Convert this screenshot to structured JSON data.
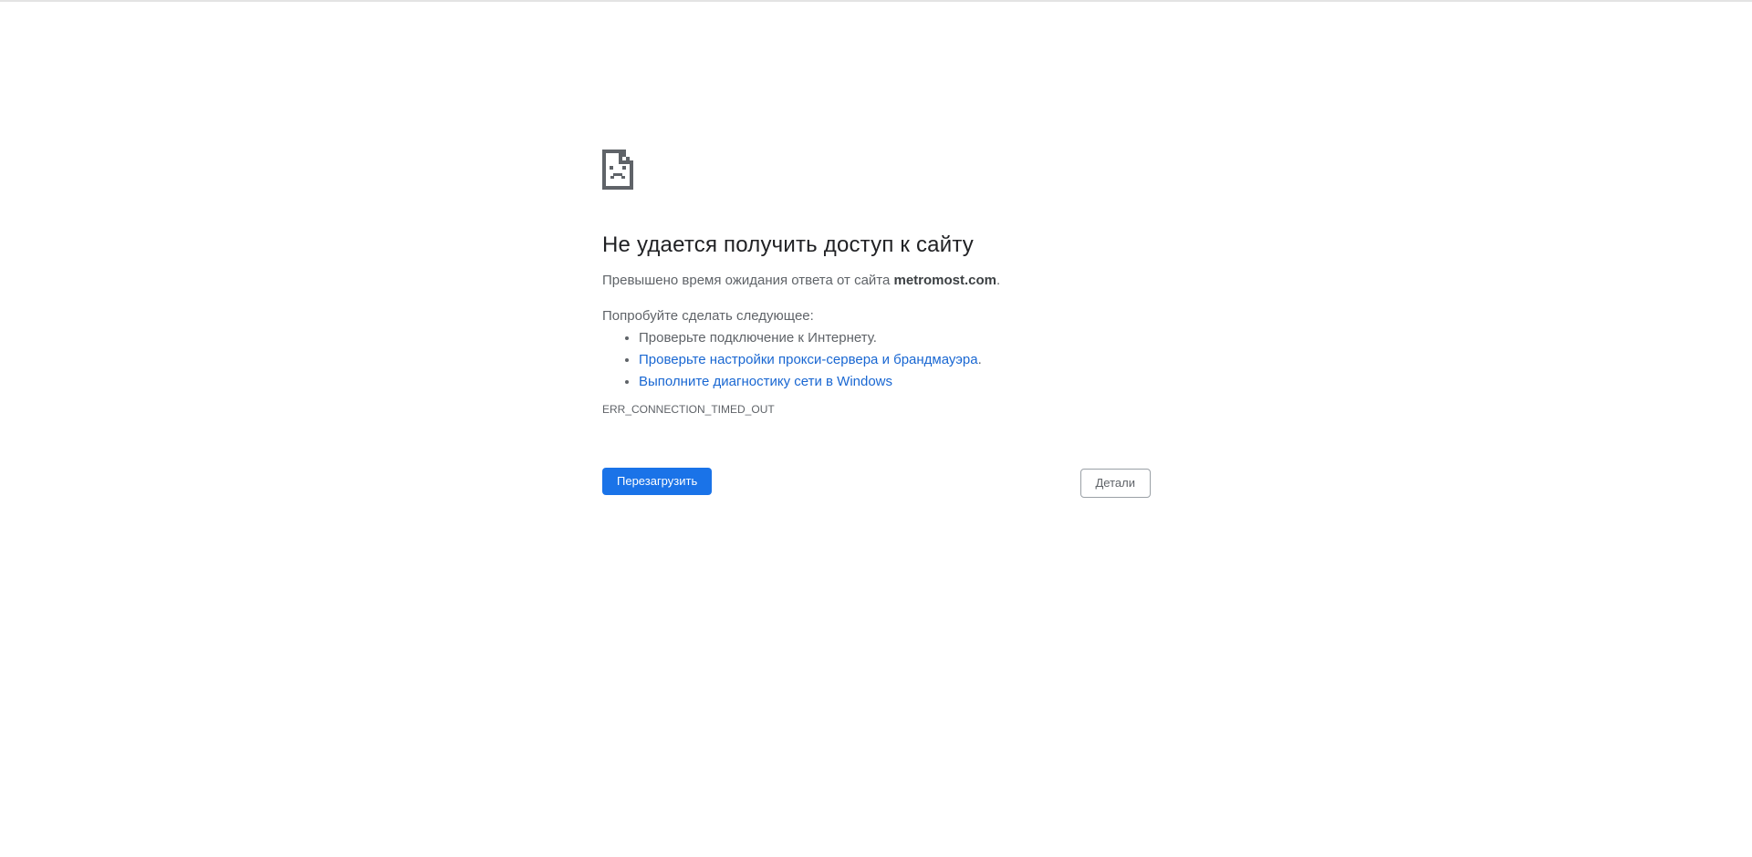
{
  "error_page": {
    "icon": "sad-document-icon",
    "title": "Не удается получить доступ к сайту",
    "summary_prefix": "Превышено время ожидания ответа от сайта ",
    "host": "metromost.com",
    "summary_suffix": ".",
    "suggestions_heading": "Попробуйте сделать следующее:",
    "suggestions": [
      {
        "text": "Проверьте подключение к Интернету.",
        "is_link": false
      },
      {
        "text": "Проверьте настройки прокси-сервера и брандмауэра",
        "suffix": ".",
        "is_link": true
      },
      {
        "text": "Выполните диагностику сети в Windows",
        "is_link": true
      }
    ],
    "error_code": "ERR_CONNECTION_TIMED_OUT",
    "reload_label": "Перезагрузить",
    "details_label": "Детали"
  },
  "colors": {
    "primary_button": "#1a73e8",
    "link": "#1967d2",
    "heading": "#202124",
    "body_text": "#5f6368"
  }
}
